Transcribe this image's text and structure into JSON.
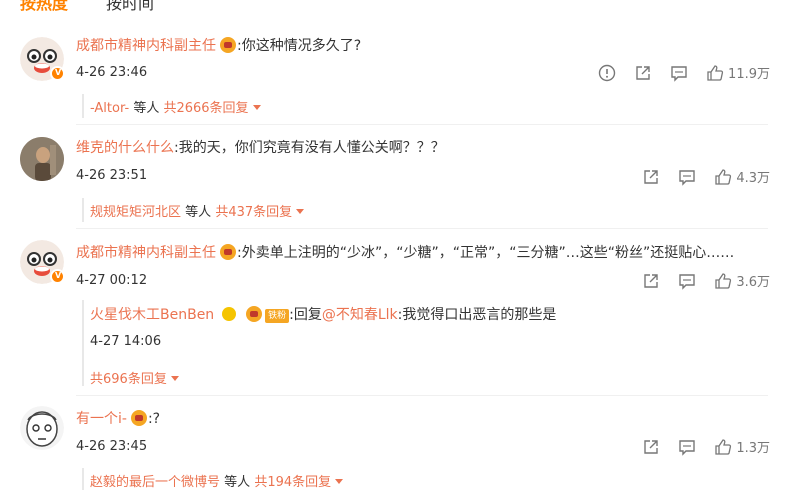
{
  "tabs": {
    "hot": "按热度",
    "time": "按时间"
  },
  "comments": [
    {
      "user": "成都市精神内科副主任",
      "text": ":你这种情况多久了?",
      "time": "4-26 23:46",
      "likes": "11.9万",
      "reply_user": "-Altor-",
      "reply_suffix": "等人",
      "reply_count": "共2666条回复"
    },
    {
      "user": "维克的什么什么",
      "text": ":我的天，你们究竟有没有人懂公关啊？？？",
      "time": "4-26 23:51",
      "likes": "4.3万",
      "reply_user": "规规矩矩河北区",
      "reply_suffix": "等人",
      "reply_count": "共437条回复"
    },
    {
      "user": "成都市精神内科副主任",
      "text": ":外卖单上注明的“少冰”，“少糖”，“正常”，“三分糖”…这些“粉丝”还挺贴心……",
      "time": "4-27 00:12",
      "likes": "3.6万",
      "sub_reply": {
        "user": "火星伐木工BenBen",
        "medal_tag": "铁粉",
        "text_prefix": ":回复",
        "mention": "@不知春Llk",
        "text": ":我觉得口出恶言的那些是",
        "time": "4-27 14:06"
      },
      "reply_count": "共696条回复"
    },
    {
      "user": "有一个i-",
      "text": ":?",
      "time": "4-26 23:45",
      "likes": "1.3万",
      "reply_user": "赵毅的最后一个微博号",
      "reply_suffix": "等人",
      "reply_count": "共194条回复"
    }
  ],
  "colors": {
    "accent": "#ff8200",
    "link": "#eb7350",
    "icon": "#777777"
  },
  "icons": [
    "report-icon",
    "share-icon",
    "comment-icon",
    "like-icon",
    "chevron-down-icon"
  ]
}
